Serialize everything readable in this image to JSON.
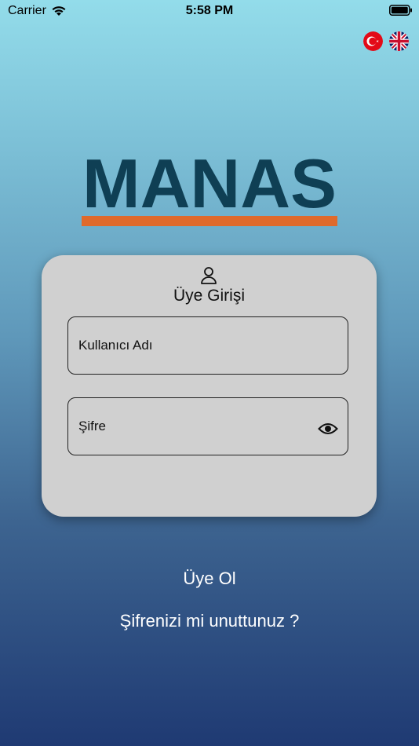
{
  "status_bar": {
    "carrier": "Carrier",
    "time": "5:58 PM"
  },
  "languages": [
    {
      "code": "tr",
      "icon": "turkey-flag-icon"
    },
    {
      "code": "en",
      "icon": "uk-flag-icon"
    }
  ],
  "logo": {
    "text": "MANAS",
    "text_color": "#0f3f54",
    "bar_color": "#e06a2b"
  },
  "login_card": {
    "icon": "user-icon",
    "title": "Üye Girişi",
    "username_placeholder": "Kullanıcı Adı",
    "password_placeholder": "Şifre",
    "password_toggle_icon": "eye-icon"
  },
  "links": {
    "register": "Üye Ol",
    "forgot_password": "Şifrenizi mi unuttunuz ?"
  },
  "colors": {
    "background_top": "#93dcea",
    "background_bottom": "#1f3a73",
    "card": "#d0d0d0"
  }
}
